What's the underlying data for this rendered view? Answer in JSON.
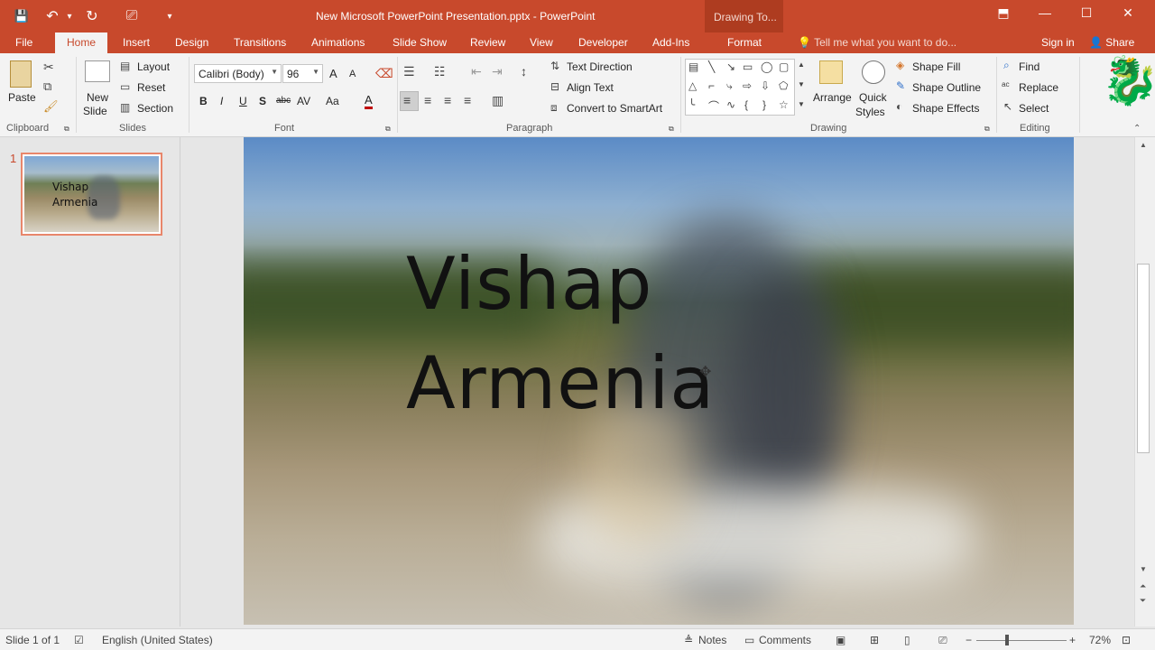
{
  "window": {
    "title": "New Microsoft PowerPoint Presentation.pptx - PowerPoint",
    "contextual_header": "Drawing To...",
    "controls": {
      "ribbon_display": "⬒",
      "minimize": "—",
      "maximize": "☐",
      "close": "✕"
    }
  },
  "qat": {
    "save": "💾",
    "undo": "↶",
    "undo_dd": "▾",
    "redo": "↻",
    "present": "⎚",
    "customize": "▾"
  },
  "tabs": {
    "file": "File",
    "home": "Home",
    "insert": "Insert",
    "design": "Design",
    "transitions": "Transitions",
    "animations": "Animations",
    "slideshow": "Slide Show",
    "review": "Review",
    "view": "View",
    "developer": "Developer",
    "addins": "Add-Ins",
    "format": "Format"
  },
  "tellme": "Tell me what you want to do...",
  "signin": "Sign in",
  "share": "Share",
  "ribbon": {
    "clipboard": {
      "label": "Clipboard",
      "paste": "Paste"
    },
    "slides": {
      "label": "Slides",
      "new_slide_1": "New",
      "new_slide_2": "Slide",
      "layout": "Layout",
      "reset": "Reset",
      "section": "Section"
    },
    "font": {
      "label": "Font",
      "family": "Calibri (Body)",
      "size": "96",
      "bold": "B",
      "italic": "I",
      "underline": "U",
      "shadow": "S",
      "strike": "abc",
      "spacing": "AV",
      "case": "Aa",
      "color": "A",
      "grow": "A",
      "shrink": "A"
    },
    "paragraph": {
      "label": "Paragraph",
      "text_direction": "Text Direction",
      "align_text": "Align Text",
      "smartart": "Convert to SmartArt"
    },
    "drawing": {
      "label": "Drawing",
      "arrange": "Arrange",
      "quick_styles_1": "Quick",
      "quick_styles_2": "Styles",
      "shape_fill": "Shape Fill",
      "shape_outline": "Shape Outline",
      "shape_effects": "Shape Effects"
    },
    "editing": {
      "label": "Editing",
      "find": "Find",
      "replace": "Replace",
      "select": "Select"
    }
  },
  "thumbnail": {
    "number": "1",
    "line1": "Vishap",
    "line2": "Armenia"
  },
  "slide": {
    "line1": "Vishap",
    "line2": "Armenia"
  },
  "status": {
    "slide_info": "Slide 1 of 1",
    "language": "English (United States)",
    "notes": "Notes",
    "comments": "Comments",
    "zoom": "72%"
  },
  "colors": {
    "accent": "#c8492c",
    "ribbon_bg": "#f3f3f3",
    "thumb_border": "#e8866b"
  }
}
